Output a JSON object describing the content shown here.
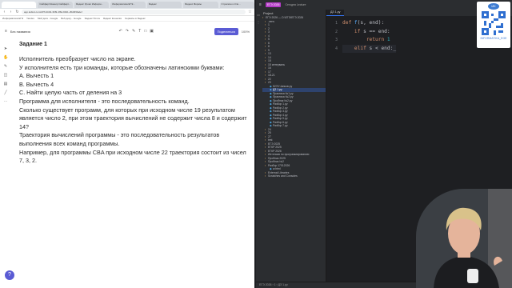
{
  "browser": {
    "tabs": [
      "",
      "Сайфарт/Нашир Сайфарт...",
      "Яндекс Уроки Информ...",
      "Информатика ЕГЭ...",
      "Яндекс",
      "Яндекс Формы",
      "Стрелкин и Кли..."
    ],
    "url": "app.koltrel.com/d/f7c1b94-36f9-4f6d-9b01-d5d0f3fadef",
    "bookmarks": [
      "Информатика ЕГЭ",
      "Yandex",
      "Мой диск - Google",
      "Веб-доку... Google",
      "Яндекс Почта",
      "Яндекс Кошелёк",
      "Сервисы в Яндекс"
    ],
    "doc_title": "Без названия",
    "share_label": "Поделиться",
    "zoom": "100%"
  },
  "document": {
    "heading": "Задание 1",
    "lines": [
      "Исполнитель преобразует число на экране.",
      "У исполнителя есть три команды, которые обозначены латинскими буквами:",
      "A. Вычесть 1",
      "B. Вычесть 4",
      "C. Найти целую часть от деления на 3",
      "Программа для исполнителя - это последовательность команд.",
      "Сколько существует программ, для которых при исходном числе 19 результатом",
      "является число 2, при этом траектория вычислений не содержит числа 8 и содержит",
      "14?",
      "Траектория вычислений программы - это последовательность результатов",
      "выполнения всех команд программы.",
      "Например, для программы CBA при исходном числе 22 траектория состоит из чисел",
      "7, 3, 2."
    ]
  },
  "ide": {
    "menu_icon": "hamburger-icon",
    "project_badge": "ЕГЭ 2026",
    "top_file": "Сегодня Lecture",
    "run_label": "test",
    "project_header": "Project",
    "tree": [
      "ЕГЭ 2026 — D:\\ЕГЭ\\ЕГЭ 2026",
      ".venv",
      "1",
      "2",
      "3",
      "4",
      "5",
      "6",
      "8",
      "9",
      "13",
      "14",
      "15",
      "15 интерваль",
      "16",
      "17",
      "18-21",
      "22",
      "23",
      "5276 Чипков.py",
      "ДЗ 1.py",
      "Практика №1.py",
      "Практика №2.py",
      "Пробник №2.py",
      "Разбор 1.py",
      "Разбор 2.py",
      "Разбор 3.py",
      "Разбор 4.py",
      "Разбор 5.py",
      "Разбор 6.py",
      "Разбор 7.py",
      "24",
      "25",
      "27",
      "test",
      "ЕГЭ 2025",
      "ЕГКР 2025",
      "ЕГКР 2026",
      "Интенсив по программированию",
      "Пробник 2025",
      "Пробник №2",
      "Разбор 17012026",
      "w.html",
      "External Libraries",
      "Scratches and Consoles"
    ],
    "selected_file": "ДЗ 1.py",
    "editor_tab": "ДЗ 1.py",
    "code_lines": [
      {
        "n": "1",
        "indent": "",
        "parts": [
          [
            "kw",
            "def "
          ],
          [
            "fn",
            "f"
          ],
          [
            "",
            "(s, end):"
          ]
        ]
      },
      {
        "n": "2",
        "indent": "    ",
        "parts": [
          [
            "kw",
            "if "
          ],
          [
            "",
            "s == end:"
          ]
        ]
      },
      {
        "n": "3",
        "indent": "        ",
        "parts": [
          [
            "kw",
            "return "
          ],
          [
            "num",
            "1"
          ]
        ]
      },
      {
        "n": "4",
        "indent": "    ",
        "parts": [
          [
            "kw",
            "elif "
          ],
          [
            "",
            "s < end:_"
          ]
        ]
      }
    ],
    "status": "ЕГЭ 2026 › 1 › ДЗ 1.py"
  },
  "overlay": {
    "logo_text": "ИК",
    "caption": "INFORMATIKA_EGE"
  }
}
